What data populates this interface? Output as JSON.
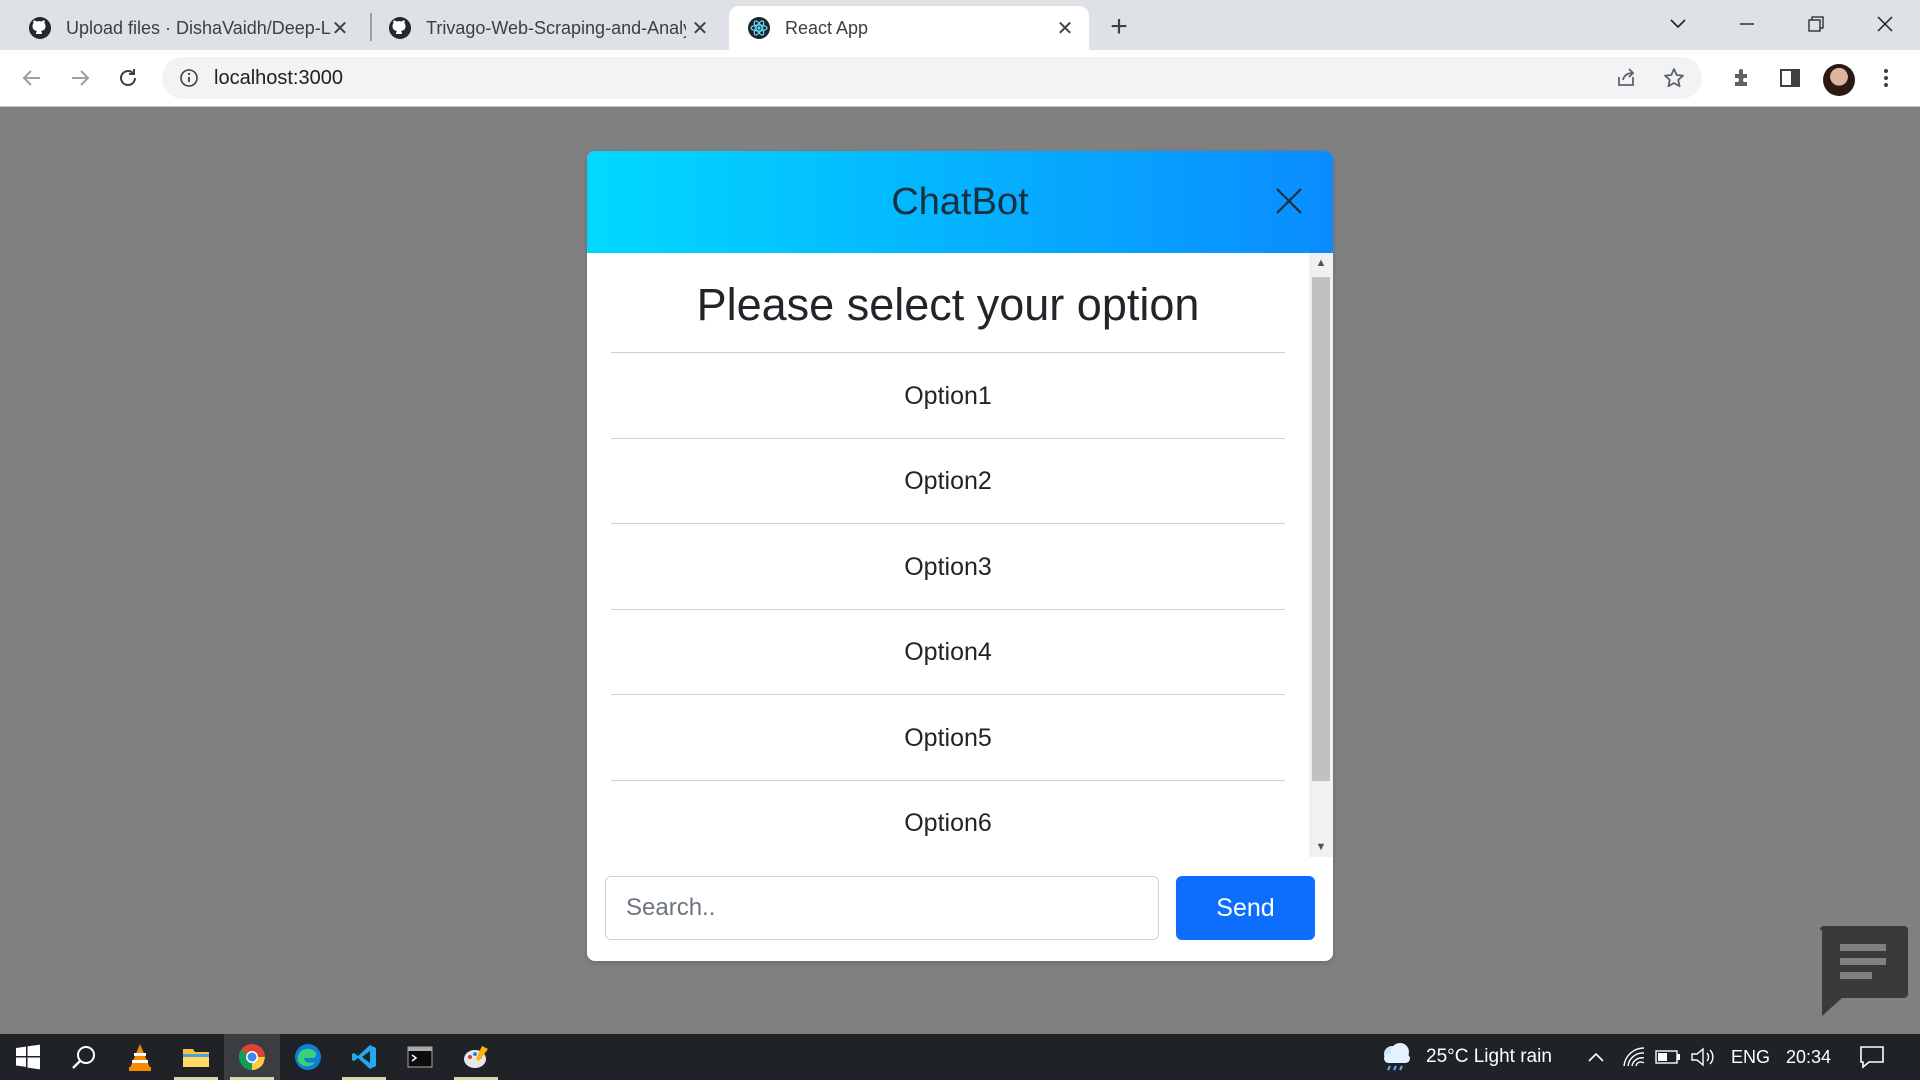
{
  "browser": {
    "tabs": [
      {
        "title": "Upload files · DishaVaidh/Deep-L",
        "icon": "github-icon"
      },
      {
        "title": "Trivago-Web-Scraping-and-Analy",
        "icon": "github-icon"
      },
      {
        "title": "React App",
        "icon": "react-icon",
        "active": true
      }
    ],
    "url": "localhost:3000"
  },
  "chatbot": {
    "title": "ChatBot",
    "prompt": "Please select your option",
    "options": [
      "Option1",
      "Option2",
      "Option3",
      "Option4",
      "Option5",
      "Option6"
    ],
    "search_placeholder": "Search..",
    "send_label": "Send",
    "header_gradient": [
      "#00d9ff",
      "#0a8cff"
    ],
    "send_color": "#0d6efd"
  },
  "taskbar": {
    "weather": "25°C  Light rain",
    "language": "ENG",
    "time": "20:34"
  }
}
